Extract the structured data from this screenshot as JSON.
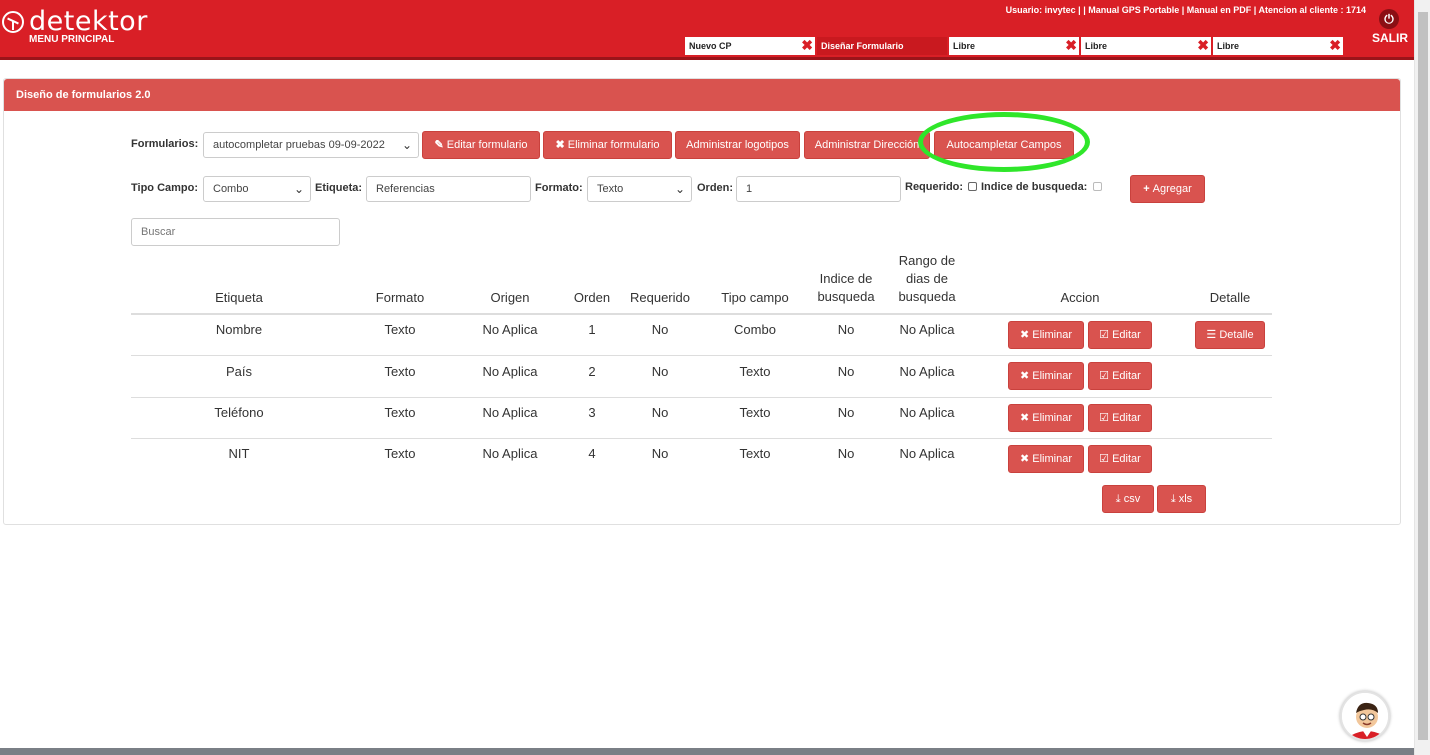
{
  "header": {
    "brand": "detektor",
    "menu": "MENU PRINCIPAL",
    "user_line": "Usuario: invytec | | Manual GPS Portable | Manual en PDF | Atencion al cliente : 1714",
    "logout": "SALIR"
  },
  "tabs": [
    {
      "label": "Nuevo CP",
      "active": false
    },
    {
      "label": "Diseñar Formulario",
      "active": true
    },
    {
      "label": "Libre",
      "active": false
    },
    {
      "label": "Libre",
      "active": false
    },
    {
      "label": "Libre",
      "active": false
    }
  ],
  "panel": {
    "title": "Diseño de formularios 2.0"
  },
  "form": {
    "formularios_label": "Formularios:",
    "formularios_value": "autocompletar pruebas 09-09-2022",
    "edit_btn": "Editar formulario",
    "delete_btn": "Eliminar formulario",
    "logos_btn": "Administrar logotipos",
    "address_btn": "Administrar Dirección",
    "autocomplete_btn": "Autocampletar Campos",
    "tipo_label": "Tipo Campo:",
    "tipo_value": "Combo",
    "etiqueta_label": "Etiqueta:",
    "etiqueta_value": "Referencias",
    "formato_label": "Formato:",
    "formato_value": "Texto",
    "orden_label": "Orden:",
    "orden_value": "1",
    "requerido_label": "Requerido:",
    "indice_label": "Indice de busqueda:",
    "add_btn": "Agregar",
    "search_placeholder": "Buscar"
  },
  "table": {
    "headers": {
      "etiqueta": "Etiqueta",
      "formato": "Formato",
      "origen": "Origen",
      "orden": "Orden",
      "requerido": "Requerido",
      "tipo": "Tipo campo",
      "indice_1": "Indice de",
      "indice_2": "busqueda",
      "rango_1": "Rango de",
      "rango_2": "dias de",
      "rango_3": "busqueda",
      "accion": "Accion",
      "detalle": "Detalle"
    },
    "rows": [
      {
        "etiqueta": "Nombre",
        "formato": "Texto",
        "origen": "No Aplica",
        "orden": "1",
        "requerido": "No",
        "tipo": "Combo",
        "indice": "No",
        "rango": "No Aplica"
      },
      {
        "etiqueta": "País",
        "formato": "Texto",
        "origen": "No Aplica",
        "orden": "2",
        "requerido": "No",
        "tipo": "Texto",
        "indice": "No",
        "rango": "No Aplica"
      },
      {
        "etiqueta": "Teléfono",
        "formato": "Texto",
        "origen": "No Aplica",
        "orden": "3",
        "requerido": "No",
        "tipo": "Texto",
        "indice": "No",
        "rango": "No Aplica"
      },
      {
        "etiqueta": "NIT",
        "formato": "Texto",
        "origen": "No Aplica",
        "orden": "4",
        "requerido": "No",
        "tipo": "Texto",
        "indice": "No",
        "rango": "No Aplica"
      }
    ],
    "eliminar": "Eliminar",
    "editar": "Editar",
    "detalle": "Detalle",
    "csv": "csv",
    "xls": "xls"
  },
  "colors": {
    "brand_red": "#d91f26",
    "button_red": "#d9534f",
    "highlight_green": "#2fe62a"
  }
}
